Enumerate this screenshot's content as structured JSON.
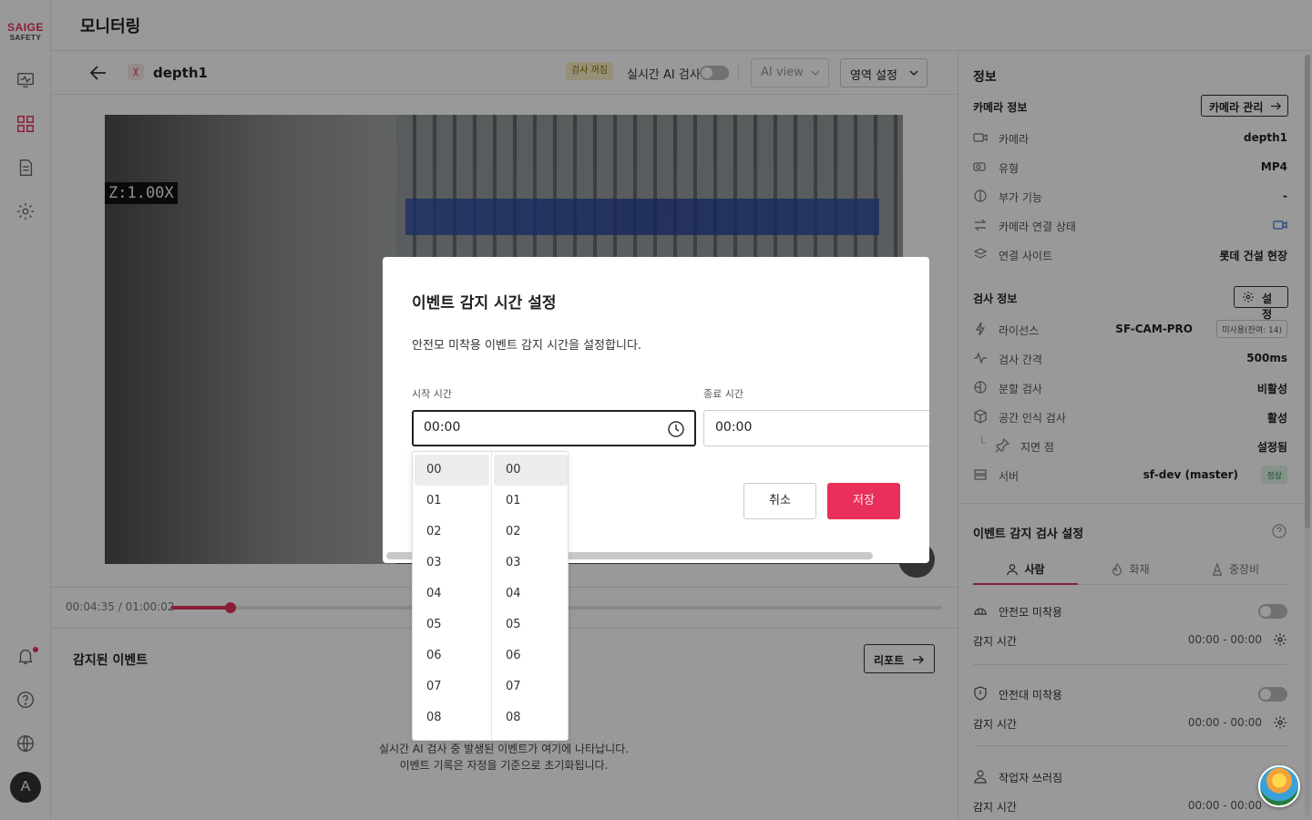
{
  "brand": {
    "name": "SAIGE",
    "sub": "SAFETY",
    "accent": "#e8305a"
  },
  "header": {
    "title": "모니터링"
  },
  "subbar": {
    "camera_name": "depth1",
    "inspection_badge": "검사 꺼짐",
    "realtime_label": "실시간 AI 검사",
    "ai_view_label": "AI view",
    "region_label": "영역 설정"
  },
  "video": {
    "zoom_label": "Z:1.00X"
  },
  "playback": {
    "time_text": "00:04:35 / 01:00:02",
    "progress": 0.0764
  },
  "events": {
    "title": "감지된 이벤트",
    "report_label": "리포트",
    "empty_line1": "실시간 AI 검사 중 발생된 이벤트가 여기에 나타납니다.",
    "empty_line2": "이벤트 기록은 자정을 기준으로 초기화됩니다."
  },
  "panel": {
    "title": "정보",
    "camera_info": {
      "title": "카메라 정보",
      "manage_label": "카메라 관리",
      "rows": [
        {
          "label": "카메라",
          "value": "depth1",
          "icon": "camera-icon"
        },
        {
          "label": "유형",
          "value": "MP4",
          "icon": "video-type-icon"
        },
        {
          "label": "부가 기능",
          "value": "-",
          "icon": "feature-icon"
        },
        {
          "label": "카메라 연결 상태",
          "value": "",
          "icon": "connection-icon"
        },
        {
          "label": "연결 사이트",
          "value": "롯데 건설 현장",
          "icon": "layers-icon"
        }
      ]
    },
    "inspection_info": {
      "title": "검사 정보",
      "settings_label": "설정",
      "rows": [
        {
          "label": "라이선스",
          "value": "SF-CAM-PRO",
          "badge": "미사용(잔여: 14)",
          "icon": "license-icon"
        },
        {
          "label": "검사 간격",
          "value": "500ms",
          "icon": "pulse-icon"
        },
        {
          "label": "분할 검사",
          "value": "비활성",
          "icon": "split-icon"
        },
        {
          "label": "공간 인식 검사",
          "value": "활성",
          "icon": "cube-icon"
        },
        {
          "label": "지면 점",
          "value": "설정됨",
          "icon": "pin-icon"
        },
        {
          "label": "서버",
          "value": "sf-dev (master)",
          "badge": "정상",
          "icon": "server-icon"
        }
      ]
    },
    "event_settings": {
      "title": "이벤트 감지 검사 설정",
      "tabs": [
        "사람",
        "화재",
        "중장비"
      ],
      "items": [
        {
          "label": "안전모 미착용",
          "time_label": "감지 시간",
          "time_value": "00:00 - 00:00",
          "icon": "helmet-icon"
        },
        {
          "label": "안전대 미착용",
          "time_label": "감지 시간",
          "time_value": "00:00 - 00:00",
          "icon": "shield-icon"
        },
        {
          "label": "작업자 쓰러짐",
          "time_label": "감지 시간",
          "time_value": "00:00 - 00:00",
          "icon": "person-icon"
        }
      ]
    }
  },
  "modal": {
    "title": "이벤트 감지 시간 설정",
    "description": "안전모 미착용 이벤트 감지 시간을 설정합니다.",
    "start_label": "시작 시간",
    "start_value": "00:00",
    "end_label": "종료 시간",
    "end_value": "00:00",
    "cancel_label": "취소",
    "save_label": "저장"
  },
  "picker": {
    "hours": [
      "00",
      "01",
      "02",
      "03",
      "04",
      "05",
      "06",
      "07",
      "08"
    ],
    "minutes": [
      "00",
      "01",
      "02",
      "03",
      "04",
      "05",
      "06",
      "07",
      "08"
    ],
    "selected_hour": "00",
    "selected_minute": "00"
  },
  "user": {
    "initial": "A"
  }
}
